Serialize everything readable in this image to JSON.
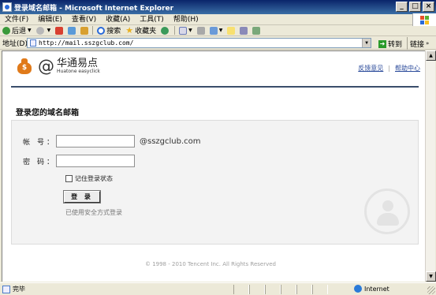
{
  "window": {
    "title": "登录域名邮箱 - Microsoft Internet Explorer"
  },
  "menu": [
    "文件(F)",
    "编辑(E)",
    "查看(V)",
    "收藏(A)",
    "工具(T)",
    "帮助(H)"
  ],
  "toolbar": {
    "back": "后退",
    "search": "搜索",
    "favorites": "收藏夹"
  },
  "address": {
    "label": "地址(D)",
    "url": "http://mail.sszgclub.com/",
    "go": "转到",
    "links": "链接"
  },
  "page": {
    "brand_cn": "华通易点",
    "brand_en": "Huatone easyclick",
    "link_feedback": "反馈意见",
    "link_help": "帮助中心",
    "heading": "登录您的域名邮箱",
    "account_label": "帐 号：",
    "account_value": "",
    "domain_suffix": "@sszgclub.com",
    "password_label": "密 码：",
    "remember": "记住登录状态",
    "login_button": "登 录",
    "secure_note": "已使用安全方式登录",
    "footer": "© 1998 - 2010 Tencent Inc. All Rights Reserved"
  },
  "status": {
    "text": "完毕",
    "zone": "Internet"
  },
  "colors": {
    "titlebar": "#0a246a",
    "header_rule": "#3a4d6b",
    "link": "#2a4a9a",
    "moneybag": "#e07a1a"
  }
}
